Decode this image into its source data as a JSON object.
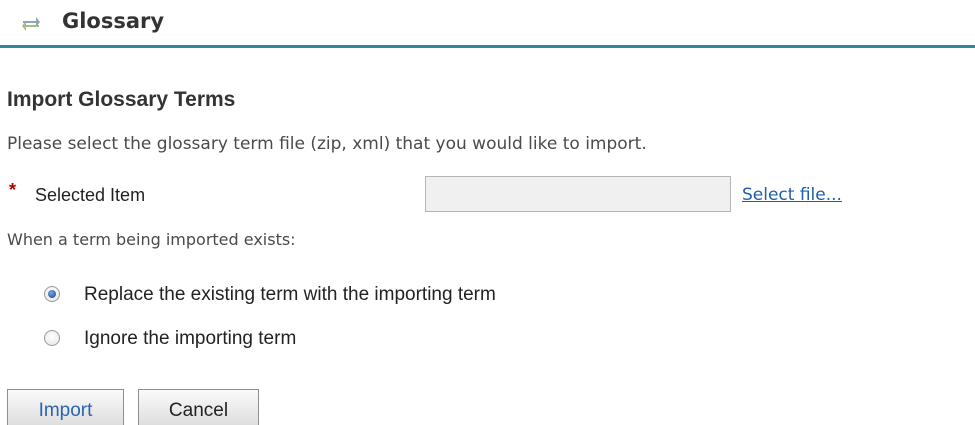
{
  "header": {
    "icon": "sync-arrows-icon",
    "title": "Glossary"
  },
  "import_section": {
    "title": "Import Glossary Terms",
    "instructions": "Please select the glossary term file (zip, xml) that you would like to import.",
    "field": {
      "required_mark": "*",
      "label": "Selected Item",
      "value": "",
      "placeholder": "",
      "select_link": "Select file..."
    },
    "exists_label": "When a term being imported exists:",
    "options": [
      {
        "label": "Replace the existing term with the importing term",
        "checked": true
      },
      {
        "label": "Ignore the importing term",
        "checked": false
      }
    ],
    "buttons": {
      "import": "Import",
      "cancel": "Cancel"
    }
  },
  "colors": {
    "header_rule": "#2a8a9a",
    "link": "#1f5fae",
    "required": "#b00000",
    "import_button_text": "#2a63b3"
  }
}
